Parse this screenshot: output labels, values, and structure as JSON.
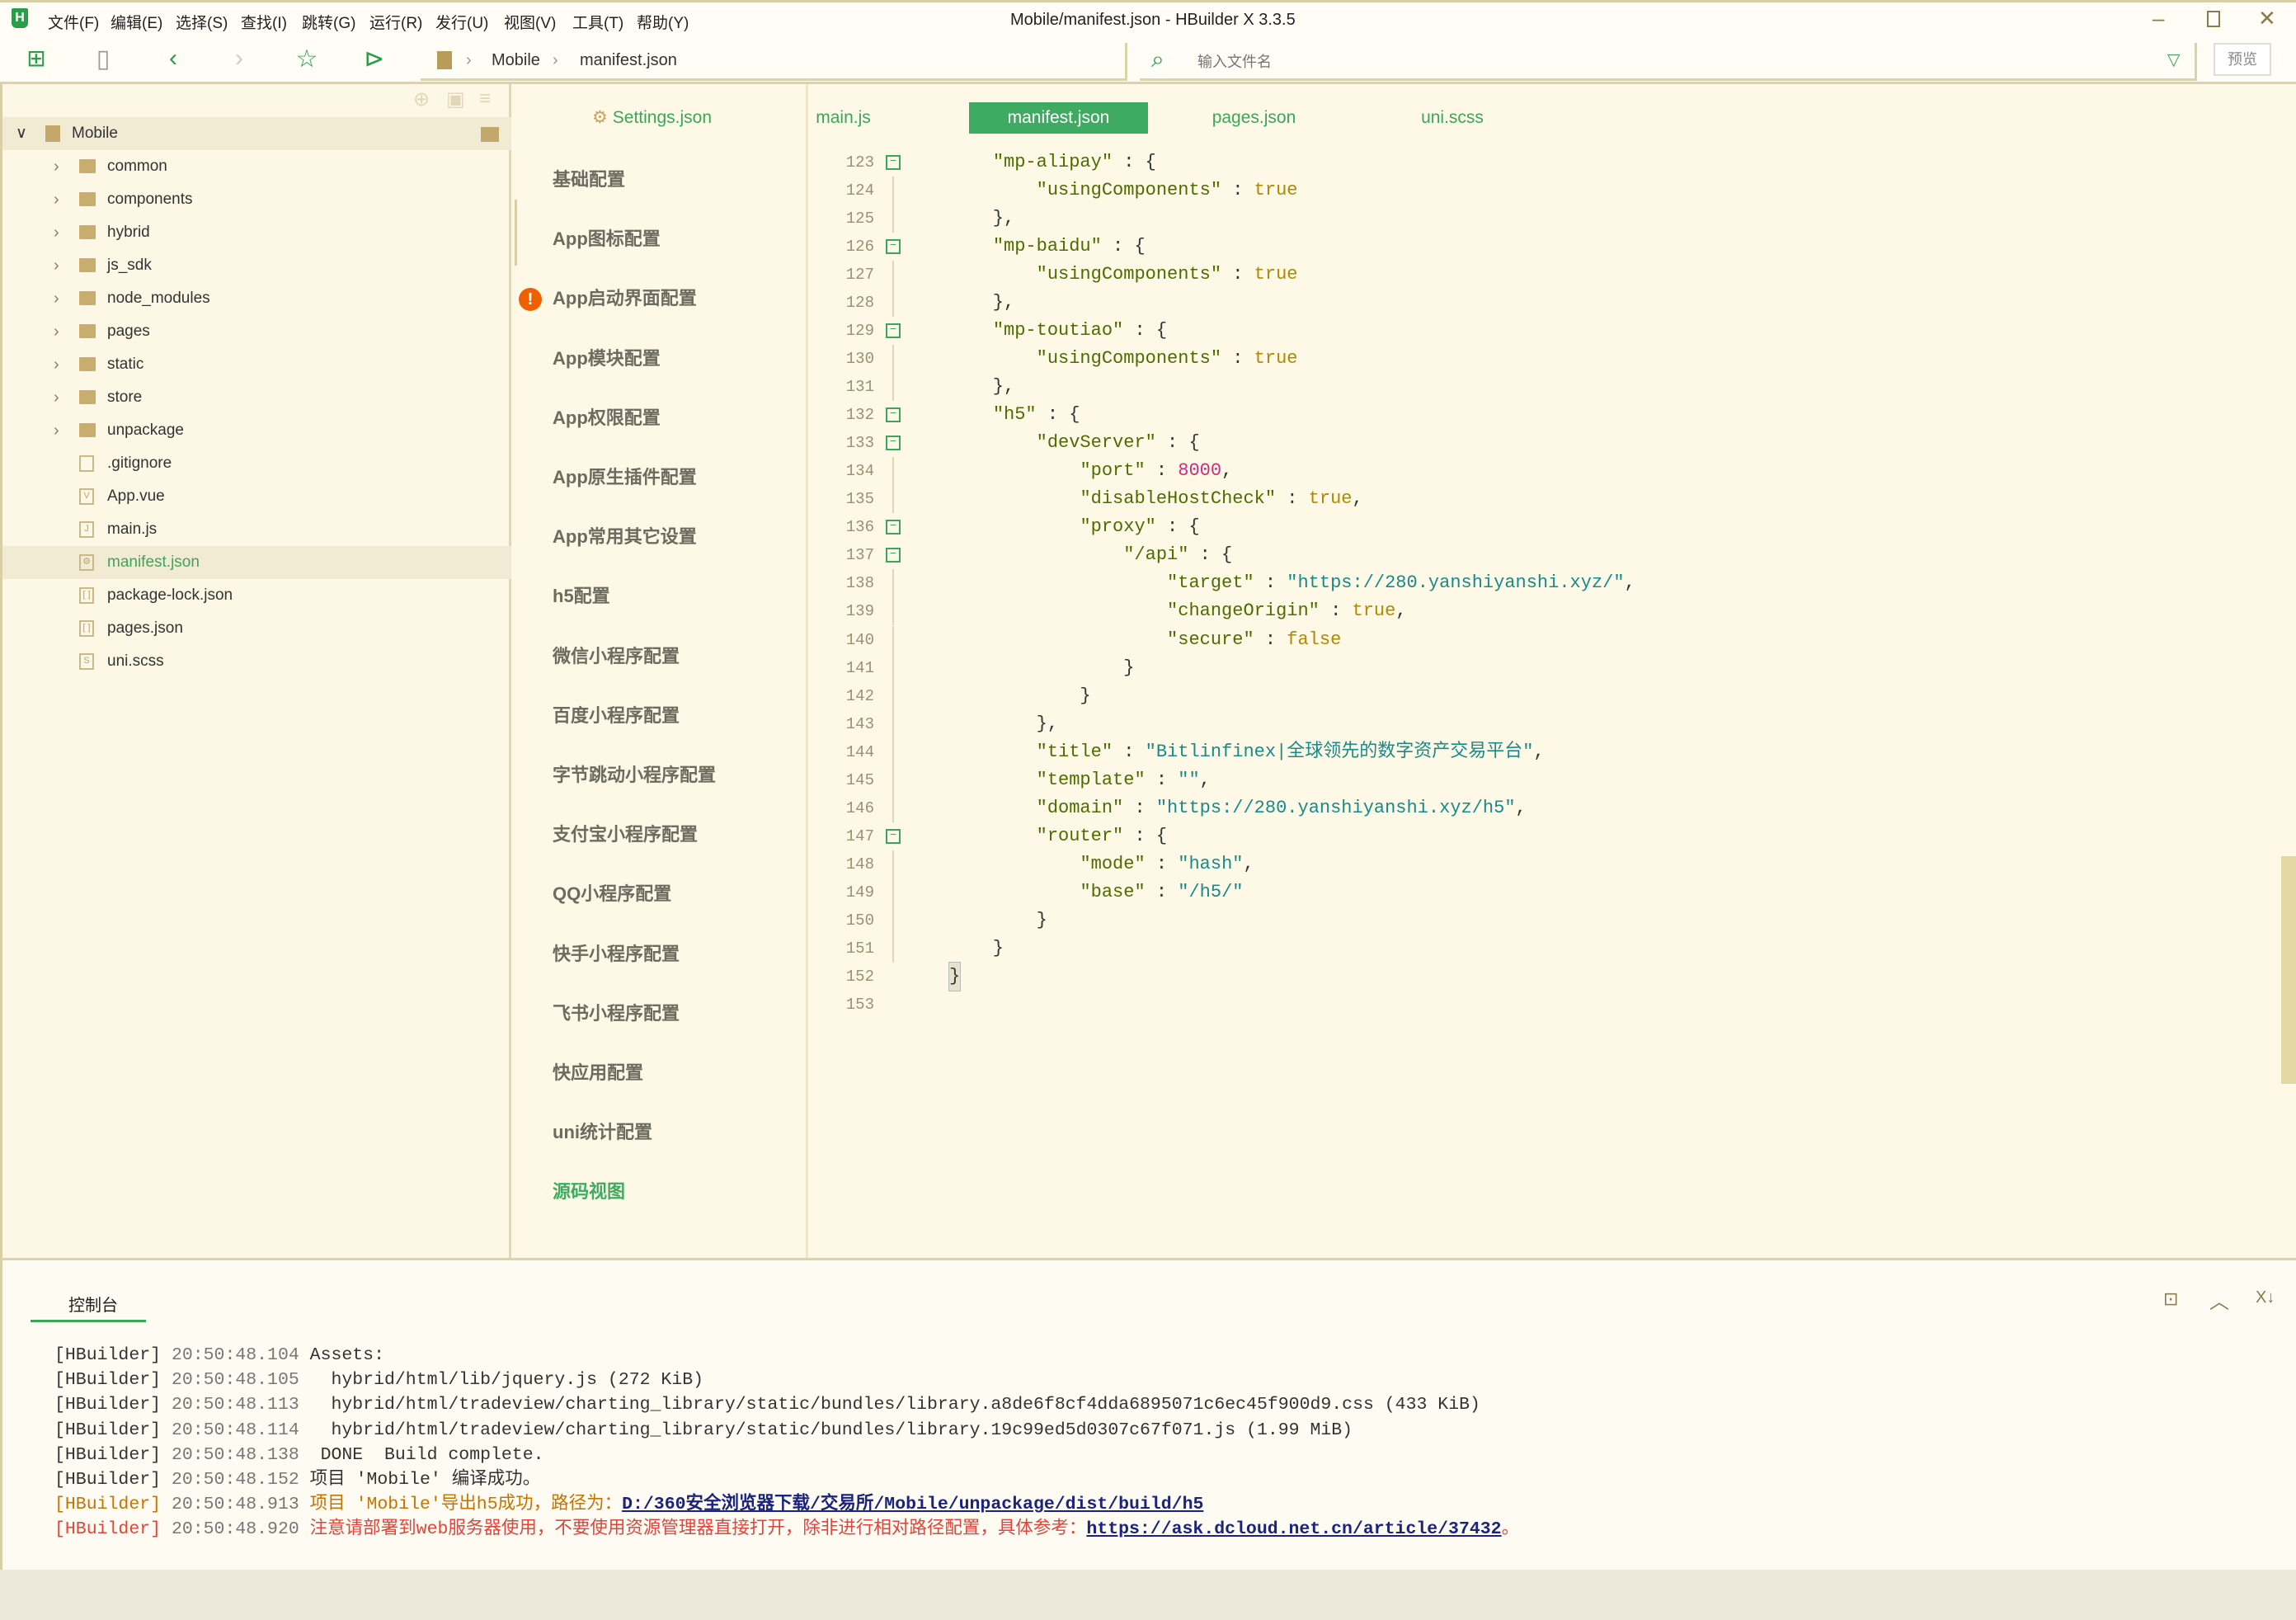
{
  "window": {
    "title": "Mobile/manifest.json - HBuilder X 3.3.5",
    "logo": "H"
  },
  "menu": [
    "文件(F)",
    "编辑(E)",
    "选择(S)",
    "查找(I)",
    "跳转(G)",
    "运行(R)",
    "发行(U)",
    "视图(V)",
    "工具(T)",
    "帮助(Y)"
  ],
  "breadcrumb": [
    "Mobile",
    "manifest.json"
  ],
  "search": {
    "placeholder": "输入文件名",
    "preview_label": "预览"
  },
  "sidebar": {
    "project": "Mobile",
    "items": [
      {
        "label": "common",
        "type": "folder"
      },
      {
        "label": "components",
        "type": "folder"
      },
      {
        "label": "hybrid",
        "type": "folder"
      },
      {
        "label": "js_sdk",
        "type": "folder"
      },
      {
        "label": "node_modules",
        "type": "folder"
      },
      {
        "label": "pages",
        "type": "folder"
      },
      {
        "label": "static",
        "type": "folder"
      },
      {
        "label": "store",
        "type": "folder"
      },
      {
        "label": "unpackage",
        "type": "folder"
      },
      {
        "label": ".gitignore",
        "type": "file",
        "icon": ""
      },
      {
        "label": "App.vue",
        "type": "file",
        "icon": "V"
      },
      {
        "label": "main.js",
        "type": "file",
        "icon": "J"
      },
      {
        "label": "manifest.json",
        "type": "file",
        "icon": "⚙",
        "selected": true
      },
      {
        "label": "package-lock.json",
        "type": "file",
        "icon": "[ ]"
      },
      {
        "label": "pages.json",
        "type": "file",
        "icon": "[ ]"
      },
      {
        "label": "uni.scss",
        "type": "file",
        "icon": "S"
      }
    ]
  },
  "tabs": [
    {
      "label": "Settings.json",
      "icon": "gear-icon"
    },
    {
      "label": "main.js"
    },
    {
      "label": "manifest.json",
      "active": true
    },
    {
      "label": "pages.json"
    },
    {
      "label": "uni.scss"
    }
  ],
  "config_nav": [
    {
      "label": "基础配置"
    },
    {
      "label": "App图标配置"
    },
    {
      "label": "App启动界面配置",
      "warning": true
    },
    {
      "label": "App模块配置"
    },
    {
      "label": "App权限配置"
    },
    {
      "label": "App原生插件配置"
    },
    {
      "label": "App常用其它设置"
    },
    {
      "label": "h5配置"
    },
    {
      "label": "微信小程序配置"
    },
    {
      "label": "百度小程序配置"
    },
    {
      "label": "字节跳动小程序配置"
    },
    {
      "label": "支付宝小程序配置"
    },
    {
      "label": "QQ小程序配置"
    },
    {
      "label": "快手小程序配置"
    },
    {
      "label": "飞书小程序配置"
    },
    {
      "label": "快应用配置"
    },
    {
      "label": "uni统计配置"
    },
    {
      "label": "源码视图",
      "active": true
    }
  ],
  "code": [
    {
      "n": 123,
      "fold": true,
      "t": [
        [
          "p",
          "    "
        ],
        [
          "k",
          "\"mp-alipay\""
        ],
        [
          "p",
          " : {"
        ]
      ]
    },
    {
      "n": 124,
      "t": [
        [
          "p",
          "        "
        ],
        [
          "k",
          "\"usingComponents\""
        ],
        [
          "p",
          " : "
        ],
        [
          "b",
          "true"
        ]
      ]
    },
    {
      "n": 125,
      "t": [
        [
          "p",
          "    },"
        ]
      ]
    },
    {
      "n": 126,
      "fold": true,
      "t": [
        [
          "p",
          "    "
        ],
        [
          "k",
          "\"mp-baidu\""
        ],
        [
          "p",
          " : {"
        ]
      ]
    },
    {
      "n": 127,
      "t": [
        [
          "p",
          "        "
        ],
        [
          "k",
          "\"usingComponents\""
        ],
        [
          "p",
          " : "
        ],
        [
          "b",
          "true"
        ]
      ]
    },
    {
      "n": 128,
      "t": [
        [
          "p",
          "    },"
        ]
      ]
    },
    {
      "n": 129,
      "fold": true,
      "t": [
        [
          "p",
          "    "
        ],
        [
          "k",
          "\"mp-toutiao\""
        ],
        [
          "p",
          " : {"
        ]
      ]
    },
    {
      "n": 130,
      "t": [
        [
          "p",
          "        "
        ],
        [
          "k",
          "\"usingComponents\""
        ],
        [
          "p",
          " : "
        ],
        [
          "b",
          "true"
        ]
      ]
    },
    {
      "n": 131,
      "t": [
        [
          "p",
          "    },"
        ]
      ]
    },
    {
      "n": 132,
      "fold": true,
      "t": [
        [
          "p",
          "    "
        ],
        [
          "k",
          "\"h5\""
        ],
        [
          "p",
          " : {"
        ]
      ]
    },
    {
      "n": 133,
      "fold": true,
      "t": [
        [
          "p",
          "        "
        ],
        [
          "k",
          "\"devServer\""
        ],
        [
          "p",
          " : {"
        ]
      ]
    },
    {
      "n": 134,
      "t": [
        [
          "p",
          "            "
        ],
        [
          "k",
          "\"port\""
        ],
        [
          "p",
          " : "
        ],
        [
          "n",
          "8000"
        ],
        [
          "p",
          ","
        ]
      ]
    },
    {
      "n": 135,
      "t": [
        [
          "p",
          "            "
        ],
        [
          "k",
          "\"disableHostCheck\""
        ],
        [
          "p",
          " : "
        ],
        [
          "b",
          "true"
        ],
        [
          "p",
          ","
        ]
      ]
    },
    {
      "n": 136,
      "fold": true,
      "t": [
        [
          "p",
          "            "
        ],
        [
          "k",
          "\"proxy\""
        ],
        [
          "p",
          " : {"
        ]
      ]
    },
    {
      "n": 137,
      "fold": true,
      "t": [
        [
          "p",
          "                "
        ],
        [
          "k",
          "\"/api\""
        ],
        [
          "p",
          " : {"
        ]
      ]
    },
    {
      "n": 138,
      "t": [
        [
          "p",
          "                    "
        ],
        [
          "k",
          "\"target\""
        ],
        [
          "p",
          " : "
        ],
        [
          "s",
          "\"https://280.yanshiyanshi.xyz/\""
        ],
        [
          "p",
          ","
        ]
      ]
    },
    {
      "n": 139,
      "t": [
        [
          "p",
          "                    "
        ],
        [
          "k",
          "\"changeOrigin\""
        ],
        [
          "p",
          " : "
        ],
        [
          "b",
          "true"
        ],
        [
          "p",
          ","
        ]
      ]
    },
    {
      "n": 140,
      "t": [
        [
          "p",
          "                    "
        ],
        [
          "k",
          "\"secure\""
        ],
        [
          "p",
          " : "
        ],
        [
          "b",
          "false"
        ]
      ]
    },
    {
      "n": 141,
      "t": [
        [
          "p",
          "                }"
        ]
      ]
    },
    {
      "n": 142,
      "t": [
        [
          "p",
          "            }"
        ]
      ]
    },
    {
      "n": 143,
      "t": [
        [
          "p",
          "        },"
        ]
      ]
    },
    {
      "n": 144,
      "t": [
        [
          "p",
          "        "
        ],
        [
          "k",
          "\"title\""
        ],
        [
          "p",
          " : "
        ],
        [
          "s",
          "\"Bitlinfinex|全球领先的数字资产交易平台\""
        ],
        [
          "p",
          ","
        ]
      ]
    },
    {
      "n": 145,
      "t": [
        [
          "p",
          "        "
        ],
        [
          "k",
          "\"template\""
        ],
        [
          "p",
          " : "
        ],
        [
          "s",
          "\"\""
        ],
        [
          "p",
          ","
        ]
      ]
    },
    {
      "n": 146,
      "t": [
        [
          "p",
          "        "
        ],
        [
          "k",
          "\"domain\""
        ],
        [
          "p",
          " : "
        ],
        [
          "s",
          "\"https://280.yanshiyanshi.xyz/h5\""
        ],
        [
          "p",
          ","
        ]
      ]
    },
    {
      "n": 147,
      "fold": true,
      "t": [
        [
          "p",
          "        "
        ],
        [
          "k",
          "\"router\""
        ],
        [
          "p",
          " : {"
        ]
      ]
    },
    {
      "n": 148,
      "t": [
        [
          "p",
          "            "
        ],
        [
          "k",
          "\"mode\""
        ],
        [
          "p",
          " : "
        ],
        [
          "s",
          "\"hash\""
        ],
        [
          "p",
          ","
        ]
      ]
    },
    {
      "n": 149,
      "t": [
        [
          "p",
          "            "
        ],
        [
          "k",
          "\"base\""
        ],
        [
          "p",
          " : "
        ],
        [
          "s",
          "\"/h5/\""
        ]
      ]
    },
    {
      "n": 150,
      "t": [
        [
          "p",
          "        }"
        ]
      ]
    },
    {
      "n": 151,
      "t": [
        [
          "p",
          "    }"
        ]
      ]
    },
    {
      "n": 152,
      "t": [
        [
          "p",
          "}"
        ]
      ]
    },
    {
      "n": 153,
      "t": []
    }
  ],
  "console": {
    "tab": "控制台",
    "lines": [
      {
        "prefix": "[HBuilder]",
        "time": "20:50:48.104",
        "msg": " Assets:"
      },
      {
        "prefix": "[HBuilder]",
        "time": "20:50:48.105",
        "msg": "   hybrid/html/lib/jquery.js (272 KiB)"
      },
      {
        "prefix": "[HBuilder]",
        "time": "20:50:48.113",
        "msg": "   hybrid/html/tradeview/charting_library/static/bundles/library.a8de6f8cf4dda6895071c6ec45f900d9.css (433 KiB)"
      },
      {
        "prefix": "[HBuilder]",
        "time": "20:50:48.114",
        "msg": "   hybrid/html/tradeview/charting_library/static/bundles/library.19c99ed5d0307c67f071.js (1.99 MiB)"
      },
      {
        "prefix": "[HBuilder]",
        "time": "20:50:48.138",
        "msg": "  DONE  Build complete."
      },
      {
        "prefix": "[HBuilder]",
        "time": "20:50:48.152",
        "msg": " 项目 'Mobile' 编译成功。"
      },
      {
        "prefix": "[HBuilder]",
        "time": "20:50:48.913",
        "msg": " 项目 'Mobile'导出h5成功，路径为：",
        "link": "D:/360安全浏览器下载/交易所/Mobile/unpackage/dist/build/h5",
        "level": "warn"
      },
      {
        "prefix": "[HBuilder]",
        "time": "20:50:48.920",
        "msg": " 注意请部署到web服务器使用，不要使用资源管理器直接打开，除非进行相对路径配置，具体参考：",
        "link": "https://ask.dcloud.net.cn/article/37432",
        "suffix": "。",
        "level": "err"
      }
    ]
  },
  "colors": {
    "accent": "#3fab62",
    "warning": "#f06000",
    "background": "#fef9e6"
  }
}
